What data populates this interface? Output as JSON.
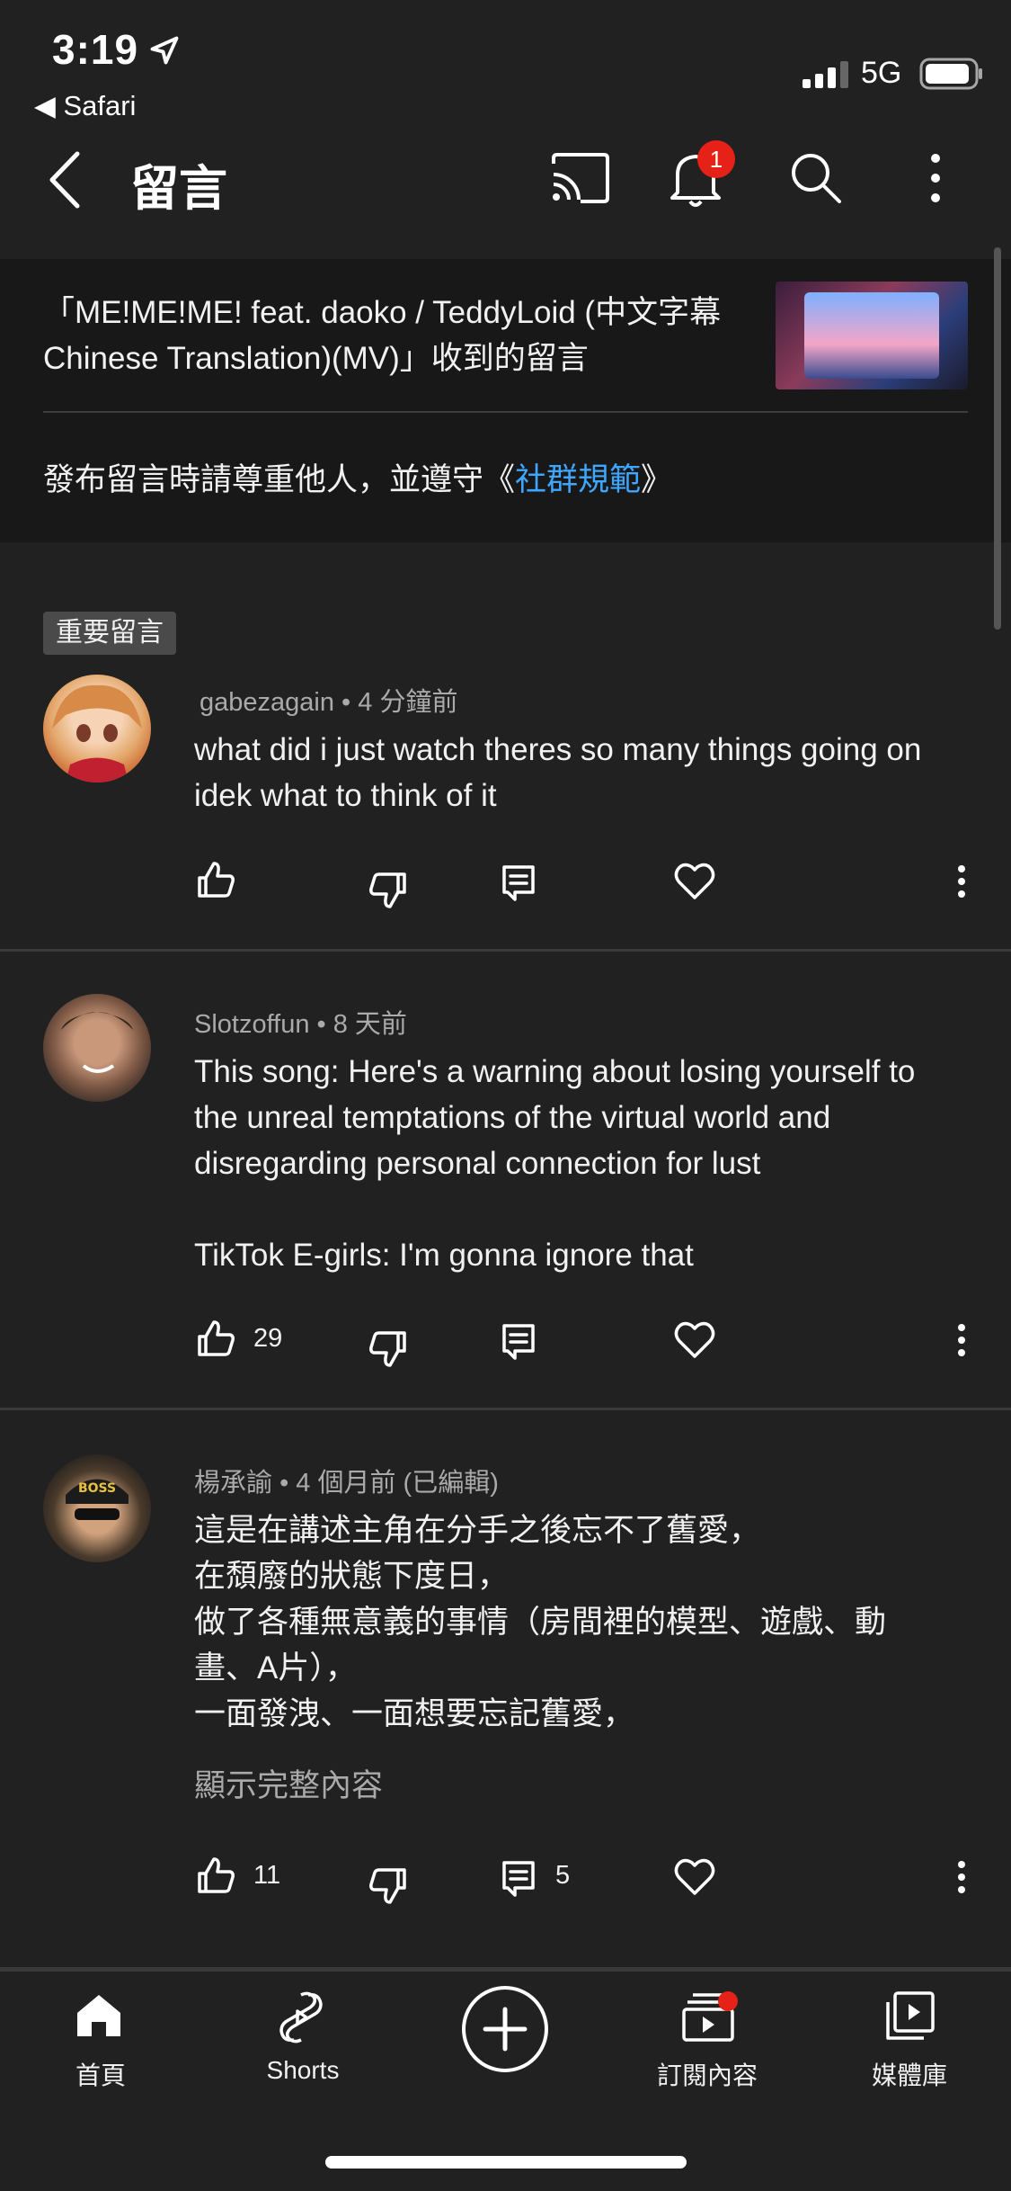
{
  "status_bar": {
    "time": "3:19",
    "back_app": "◀ Safari",
    "network": "5G"
  },
  "header": {
    "title": "留言",
    "notification_count": "1"
  },
  "info": {
    "video_title": "「ME!ME!ME! feat. daoko / TeddyLoid (中文字幕 Chinese Translation)(MV)」收到的留言",
    "guideline_prefix": "發布留言時請尊重他人，並遵守《",
    "guideline_link": "社群規範",
    "guideline_suffix": "》"
  },
  "comments": [
    {
      "badge": "重要留言",
      "author": "gabezagain",
      "time": "• 4 分鐘前",
      "lines": [
        "what did i just watch theres so many things going on",
        "idek what to think of it"
      ],
      "likes": "",
      "replies": ""
    },
    {
      "author": "Slotzoffun",
      "time": "• 8 天前",
      "lines": [
        "This song: Here's a warning about losing yourself to",
        "the unreal temptations of the virtual world and",
        "disregarding personal connection for lust",
        "",
        "TikTok E-girls: I'm gonna ignore that"
      ],
      "likes": "29",
      "replies": ""
    },
    {
      "author": "楊承諭",
      "time": "• 4 個月前 (已編輯)",
      "lines": [
        "這是在講述主角在分手之後忘不了舊愛，",
        "在頹廢的狀態下度日，",
        "做了各種無意義的事情（房間裡的模型、遊戲、動",
        "畫、A片），",
        "一面發洩、一面想要忘記舊愛，"
      ],
      "show_more": "顯示完整內容",
      "likes": "11",
      "replies": "5"
    }
  ],
  "bottom_nav": [
    {
      "label": "首頁",
      "icon": "home-icon"
    },
    {
      "label": "Shorts",
      "icon": "shorts-icon"
    },
    {
      "label": "",
      "icon": "create-icon"
    },
    {
      "label": "訂閱內容",
      "icon": "subscriptions-icon"
    },
    {
      "label": "媒體庫",
      "icon": "library-icon"
    }
  ],
  "colors": {
    "background": "#212121",
    "panel": "#181818",
    "link": "#3ea6ff",
    "badge_red": "#e62117"
  }
}
